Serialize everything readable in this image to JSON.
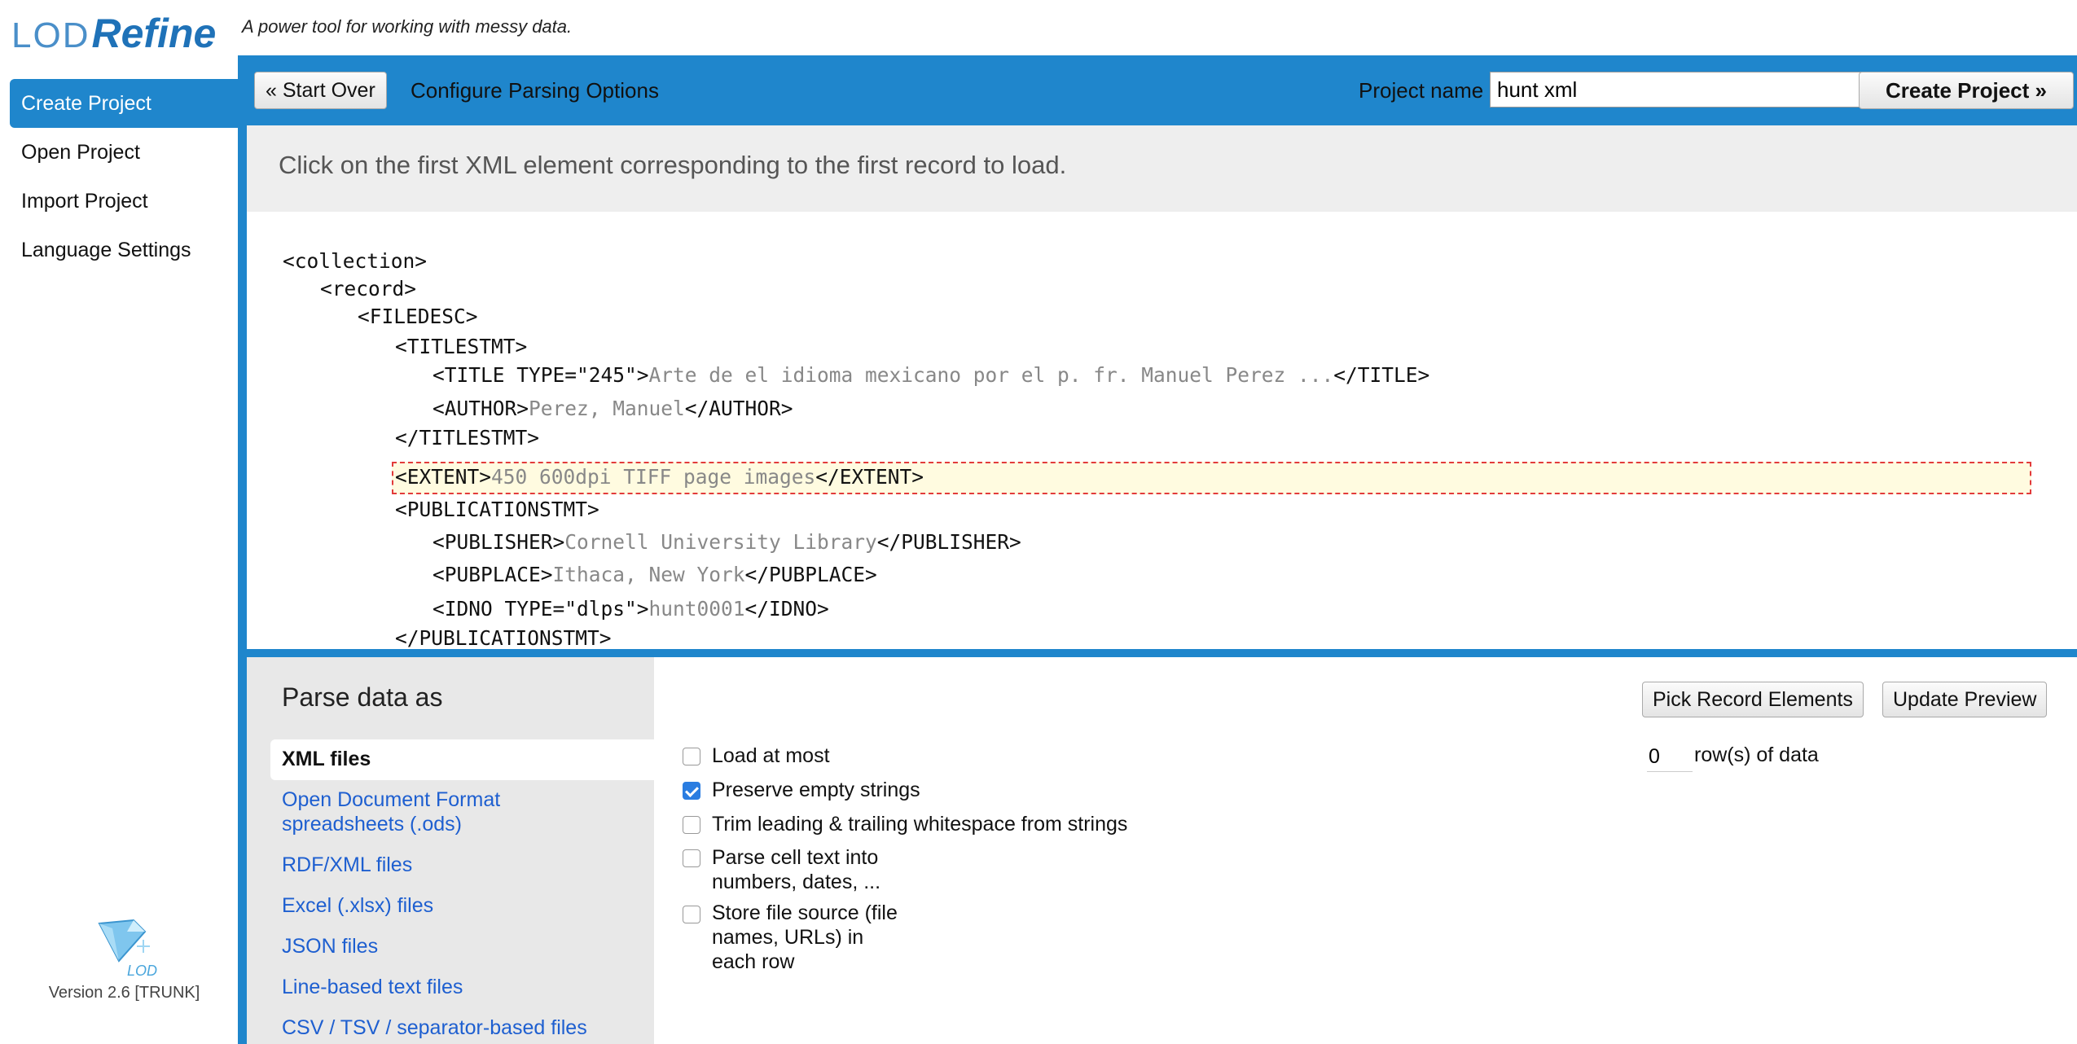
{
  "app": {
    "logo_lod": "LOD",
    "logo_refine": "Refine",
    "tagline": "A power tool for working with messy data.",
    "version": "Version 2.6 [TRUNK]",
    "version_logo_text": "LOD"
  },
  "nav": {
    "items": [
      {
        "label": "Create Project",
        "active": true
      },
      {
        "label": "Open Project"
      },
      {
        "label": "Import Project"
      },
      {
        "label": "Language Settings"
      }
    ]
  },
  "toolbar": {
    "start_over": "« Start Over",
    "title": "Configure Parsing Options",
    "project_name_label": "Project name",
    "project_name_value": "hunt xml",
    "create_project": "Create Project »"
  },
  "instruction": "Click on the first XML element corresponding to the first record to load.",
  "xml_lines": [
    {
      "tag_open": "<collection>",
      "value": "",
      "tag_close": ""
    },
    {
      "tag_open": "<record>",
      "value": "",
      "tag_close": ""
    },
    {
      "tag_open": "<FILEDESC>",
      "value": "",
      "tag_close": ""
    },
    {
      "tag_open": "<TITLESTMT>",
      "value": "",
      "tag_close": ""
    },
    {
      "tag_open": "<TITLE TYPE=\"245\">",
      "value": "Arte de el idioma mexicano por el p. fr. Manuel Perez ...",
      "tag_close": "</TITLE>"
    },
    {
      "tag_open": "<AUTHOR>",
      "value": "Perez, Manuel",
      "tag_close": "</AUTHOR>"
    },
    {
      "tag_open": "</TITLESTMT>",
      "value": "",
      "tag_close": ""
    },
    {
      "tag_open": "<EXTENT>",
      "value": "450 600dpi TIFF page images",
      "tag_close": "</EXTENT>"
    },
    {
      "tag_open": "<PUBLICATIONSTMT>",
      "value": "",
      "tag_close": ""
    },
    {
      "tag_open": "<PUBLISHER>",
      "value": "Cornell University Library",
      "tag_close": "</PUBLISHER>"
    },
    {
      "tag_open": "<PUBPLACE>",
      "value": "Ithaca, New York",
      "tag_close": "</PUBPLACE>"
    },
    {
      "tag_open": "<IDNO TYPE=\"dlps\">",
      "value": "hunt0001",
      "tag_close": "</IDNO>"
    },
    {
      "tag_open": "</PUBLICATIONSTMT>",
      "value": "",
      "tag_close": ""
    }
  ],
  "parse": {
    "title": "Parse data as",
    "formats": [
      {
        "label": "XML files",
        "selected": true
      },
      {
        "label": "Open Document Format spreadsheets (.ods)"
      },
      {
        "label": "RDF/XML files"
      },
      {
        "label": "Excel (.xlsx) files"
      },
      {
        "label": "JSON files"
      },
      {
        "label": "Line-based text files"
      },
      {
        "label": "CSV / TSV / separator-based files"
      }
    ],
    "options": [
      {
        "label": "Load at most",
        "checked": false
      },
      {
        "label": "Preserve empty strings",
        "checked": true
      },
      {
        "label": "Trim leading & trailing whitespace from strings",
        "checked": false
      },
      {
        "label": "Parse cell text into numbers, dates, ...",
        "checked": false
      },
      {
        "label": "Store file source (file names, URLs) in each row",
        "checked": false
      }
    ],
    "pick_record_elements": "Pick Record Elements",
    "update_preview": "Update Preview",
    "rows_value": "0",
    "rows_label": "row(s) of data"
  }
}
